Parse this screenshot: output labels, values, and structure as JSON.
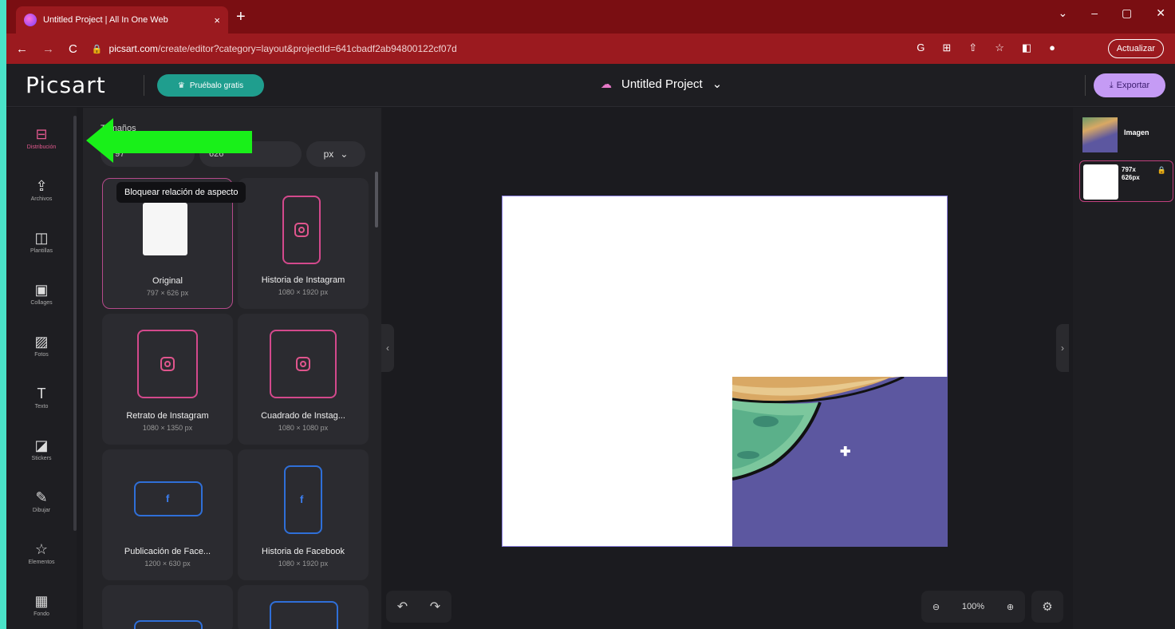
{
  "browser": {
    "tab_title": "Untitled Project | All In One Web",
    "tab_close": "×",
    "new_tab": "+",
    "url_domain": "picsart.com",
    "url_path": "/create/editor?category=layout&projectId=641cbadf2ab94800122cf07d",
    "update_label": "Actualizar",
    "window_controls": [
      "⌄",
      "–",
      "▢",
      "✕"
    ]
  },
  "header": {
    "logo": "Picsart",
    "try_label": "Pruébalo gratis",
    "project_title": "Untitled Project",
    "export_label": "Exportar"
  },
  "sidebar": {
    "items": [
      {
        "label": "Distribución",
        "icon": "layout-icon",
        "glyph": "⊟",
        "active": true
      },
      {
        "label": "Archivos",
        "icon": "upload-icon",
        "glyph": "⇪"
      },
      {
        "label": "Plantillas",
        "icon": "templates-icon",
        "glyph": "◫"
      },
      {
        "label": "Collages",
        "icon": "collage-icon",
        "glyph": "▣"
      },
      {
        "label": "Fotos",
        "icon": "photos-icon",
        "glyph": "▨"
      },
      {
        "label": "Texto",
        "icon": "text-icon",
        "glyph": "T"
      },
      {
        "label": "Stickers",
        "icon": "sticker-icon",
        "glyph": "◪"
      },
      {
        "label": "Dibujar",
        "icon": "brush-icon",
        "glyph": "✎"
      },
      {
        "label": "Elementos",
        "icon": "star-icon",
        "glyph": "☆"
      },
      {
        "label": "Fondo",
        "icon": "background-icon",
        "glyph": "▦"
      }
    ]
  },
  "panel": {
    "title": "Tamaños",
    "width_value": "797",
    "height_value": "626",
    "unit": "px",
    "tooltip": "Bloquear relación de aspecto",
    "cards": [
      {
        "label": "Original",
        "size": "797 × 626 px",
        "kind": "original"
      },
      {
        "label": "Historia de Instagram",
        "size": "1080 × 1920 px",
        "kind": "instagram"
      },
      {
        "label": "Retrato de Instagram",
        "size": "1080 × 1350 px",
        "kind": "instagram"
      },
      {
        "label": "Cuadrado de Instag...",
        "size": "1080 × 1080 px",
        "kind": "instagram"
      },
      {
        "label": "Publicación de Face...",
        "size": "1200 × 630 px",
        "kind": "facebook"
      },
      {
        "label": "Historia de Facebook",
        "size": "1080 × 1920 px",
        "kind": "facebook"
      }
    ]
  },
  "canvas": {
    "zoom": "100%"
  },
  "layers": {
    "items": [
      {
        "name": "Imagen"
      },
      {
        "size": "797x 626px"
      }
    ]
  },
  "colors": {
    "accent_pink": "#e2598f",
    "teal": "#1f9e8e",
    "export_purple": "#c59bf5",
    "browser_red": "#9b1a1f",
    "annotation_green": "#19f019",
    "image_purple": "#5c57a0"
  }
}
